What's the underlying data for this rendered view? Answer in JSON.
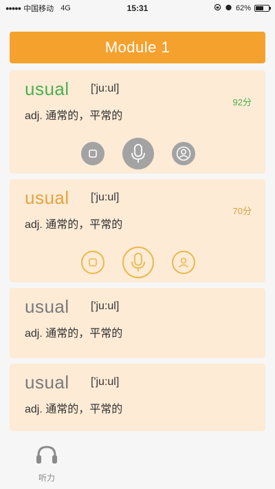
{
  "status": {
    "signal": "●●●●●",
    "carrier": "中国移动",
    "network": "4G",
    "time": "15:31",
    "battery": "62%",
    "battery_level": 0.62
  },
  "header": {
    "title": "Module 1"
  },
  "cards": [
    {
      "word": "usual",
      "phonetic": "['ju:ul]",
      "meaning": "adj.  通常的，平常的",
      "score": "92分",
      "word_color": "#4caf50",
      "score_color": "#4caf50"
    },
    {
      "word": "usual",
      "phonetic": "['ju:ul]",
      "meaning": "adj.  通常的，平常的",
      "score": "70分",
      "word_color": "#e6a23c",
      "score_color": "#d4a13a"
    },
    {
      "word": "usual",
      "phonetic": "['ju:ul]",
      "meaning": "adj.  通常的，平常的"
    },
    {
      "word": "usual",
      "phonetic": "['ju:ul]",
      "meaning": "adj.  通常的，平常的"
    }
  ],
  "tabbar": {
    "listen_label": "听力"
  },
  "icons": {
    "stop": "stop-icon",
    "mic": "microphone-icon",
    "user": "user-icon",
    "headphones": "headphones-icon"
  },
  "colors": {
    "accent": "#f5a12e",
    "card_bg": "#fdebd6",
    "gold": "#e9b84a",
    "gray_control": "#a3a3a3"
  }
}
